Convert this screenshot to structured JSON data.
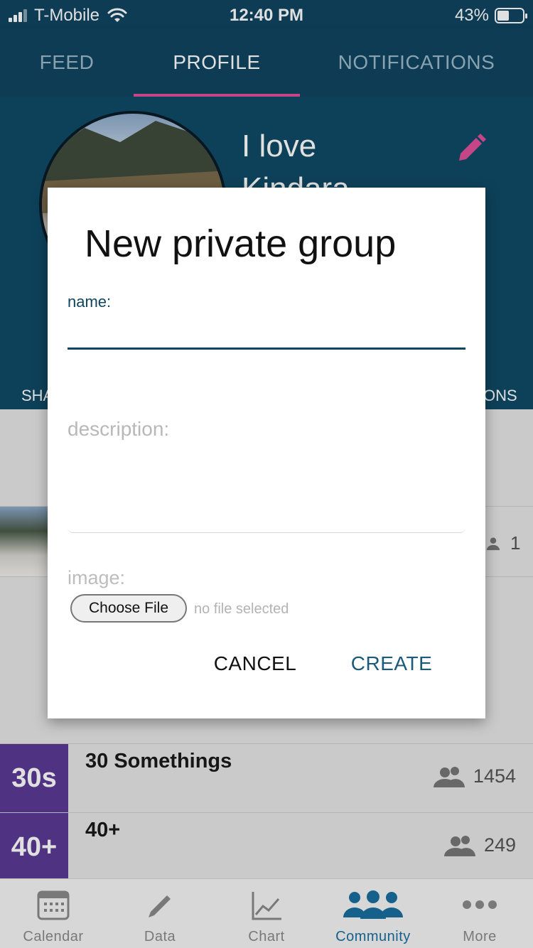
{
  "status_bar": {
    "carrier": "T-Mobile",
    "time": "12:40 PM",
    "battery": "43%"
  },
  "tabs": [
    {
      "label": "FEED",
      "active": false
    },
    {
      "label": "PROFILE",
      "active": true
    },
    {
      "label": "NOTIFICATIONS",
      "active": false
    }
  ],
  "profile": {
    "name": "I love Kindara",
    "stat_left_fragment": "SHA",
    "stat_right_fragment": "ONS"
  },
  "group_strip": {
    "count": "1"
  },
  "groups": [
    {
      "badge": "30s",
      "name": "30 Somethings",
      "members": "1454"
    },
    {
      "badge": "40+",
      "name": "40+",
      "members": "249"
    }
  ],
  "dialog": {
    "title": "New private group",
    "name_label": "name:",
    "name_value": "",
    "description_placeholder": "description:",
    "image_label": "image:",
    "choose_file_label": "Choose File",
    "file_status": "no file selected",
    "cancel_label": "CANCEL",
    "create_label": "CREATE"
  },
  "bottom_nav": [
    {
      "label": "Calendar",
      "icon": "calendar-icon",
      "active": false
    },
    {
      "label": "Data",
      "icon": "pencil-icon",
      "active": false
    },
    {
      "label": "Chart",
      "icon": "line-chart-icon",
      "active": false
    },
    {
      "label": "Community",
      "icon": "people-icon",
      "active": true
    },
    {
      "label": "More",
      "icon": "more-dots-icon",
      "active": false
    }
  ],
  "colors": {
    "primary": "#0f4560",
    "accent": "#e0509a",
    "group_badge": "#5b3a94",
    "nav_active": "#1a6fa0"
  }
}
